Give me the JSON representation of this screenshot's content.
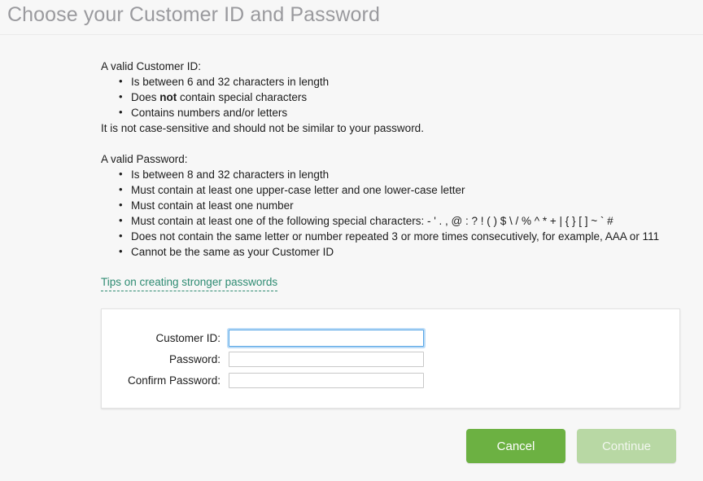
{
  "header": {
    "title": "Choose your Customer ID and Password"
  },
  "customer_id_requirements": {
    "heading": "A valid Customer ID:",
    "items": [
      "Is between 6 and 32 characters in length",
      "Does not contain special characters",
      "Contains numbers and/or letters"
    ],
    "bold_word": "not",
    "item_2_prefix": "Does ",
    "item_2_suffix": " contain special characters",
    "footnote": "It is not case-sensitive and should not be similar to your password."
  },
  "password_requirements": {
    "heading": "A valid Password:",
    "items": [
      "Is between 8 and 32 characters in length",
      "Must contain at least one upper-case letter and one lower-case letter",
      "Must contain at least one number",
      "Must contain at least one of the following special characters: - ' . , @ : ? ! ( ) $ \\ / % ^ * + | { } [ ] ~ ` #",
      "Does not contain the same letter or number repeated 3 or more times consecutively, for example, AAA or 111",
      "Cannot be the same as your Customer ID"
    ]
  },
  "tips_link": {
    "label": "Tips on creating stronger passwords"
  },
  "form": {
    "fields": [
      {
        "label": "Customer ID:",
        "value": "",
        "placeholder": ""
      },
      {
        "label": "Password:",
        "value": "",
        "placeholder": ""
      },
      {
        "label": "Confirm Password:",
        "value": "",
        "placeholder": ""
      }
    ]
  },
  "footer": {
    "cancel_label": "Cancel",
    "continue_label": "Continue"
  },
  "colors": {
    "page_background": "#f7f7f7",
    "title": "#9a9a9e",
    "link": "#2e8b72",
    "cancel_button": "#6cb142",
    "continue_button": "#b8d8a4",
    "focus_ring": "#bcdcf7",
    "focus_border": "#5aa7e6"
  }
}
